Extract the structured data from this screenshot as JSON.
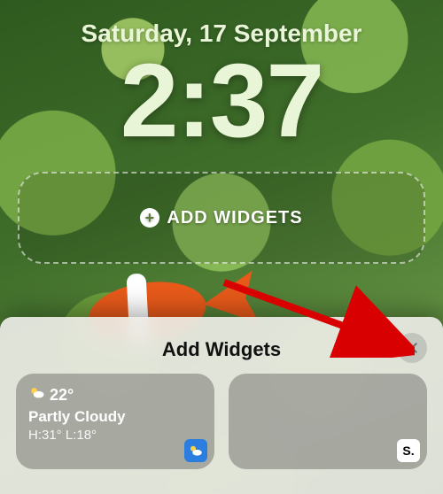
{
  "lockscreen": {
    "date": "Saturday, 17 September",
    "time": "2:37",
    "add_widgets_button": "ADD WIDGETS"
  },
  "sheet": {
    "title": "Add Widgets",
    "cards": [
      {
        "temp": "22°",
        "condition": "Partly Cloudy",
        "hi_lo": "H:31° L:18°",
        "app_badge": "weather"
      },
      {
        "app_badge_text": "S."
      }
    ]
  }
}
